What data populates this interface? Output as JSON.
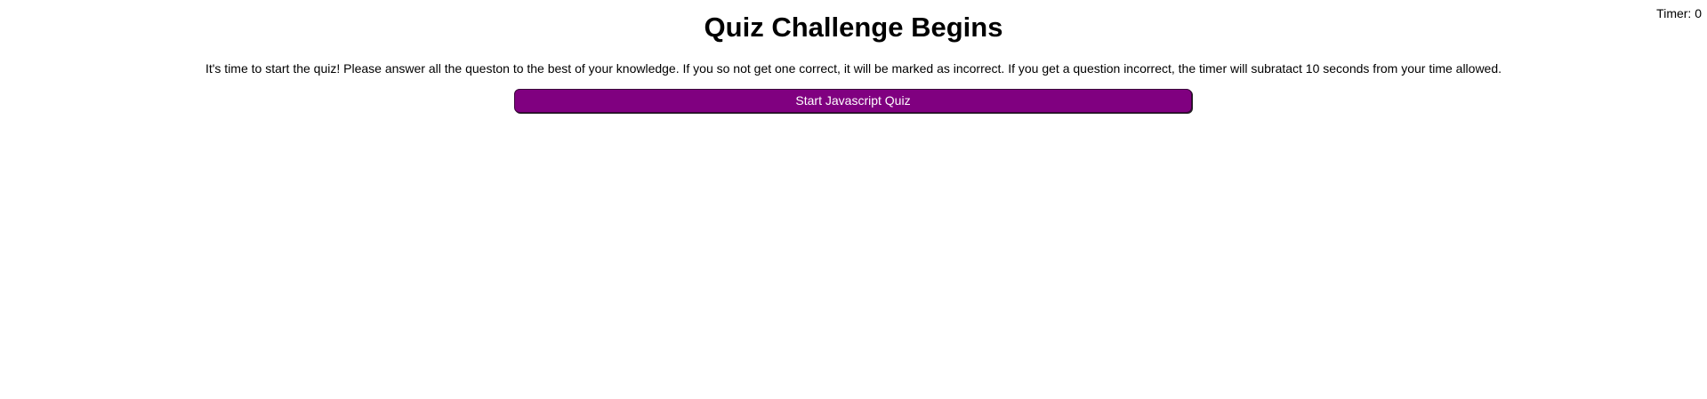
{
  "header": {
    "timer_text": "Timer: 0"
  },
  "main": {
    "title": "Quiz Challenge Begins",
    "intro": "It's time to start the quiz! Please answer all the queston to the best of your knowledge. If you so not get one correct, it will be marked as incorrect. If you get a question incorrect, the timer will subratact 10 seconds from your time allowed.",
    "start_button_label": "Start Javascript Quiz"
  },
  "colors": {
    "button_background": "#800080",
    "button_text": "#ffffff",
    "page_background": "#ffffff",
    "text": "#000000"
  }
}
